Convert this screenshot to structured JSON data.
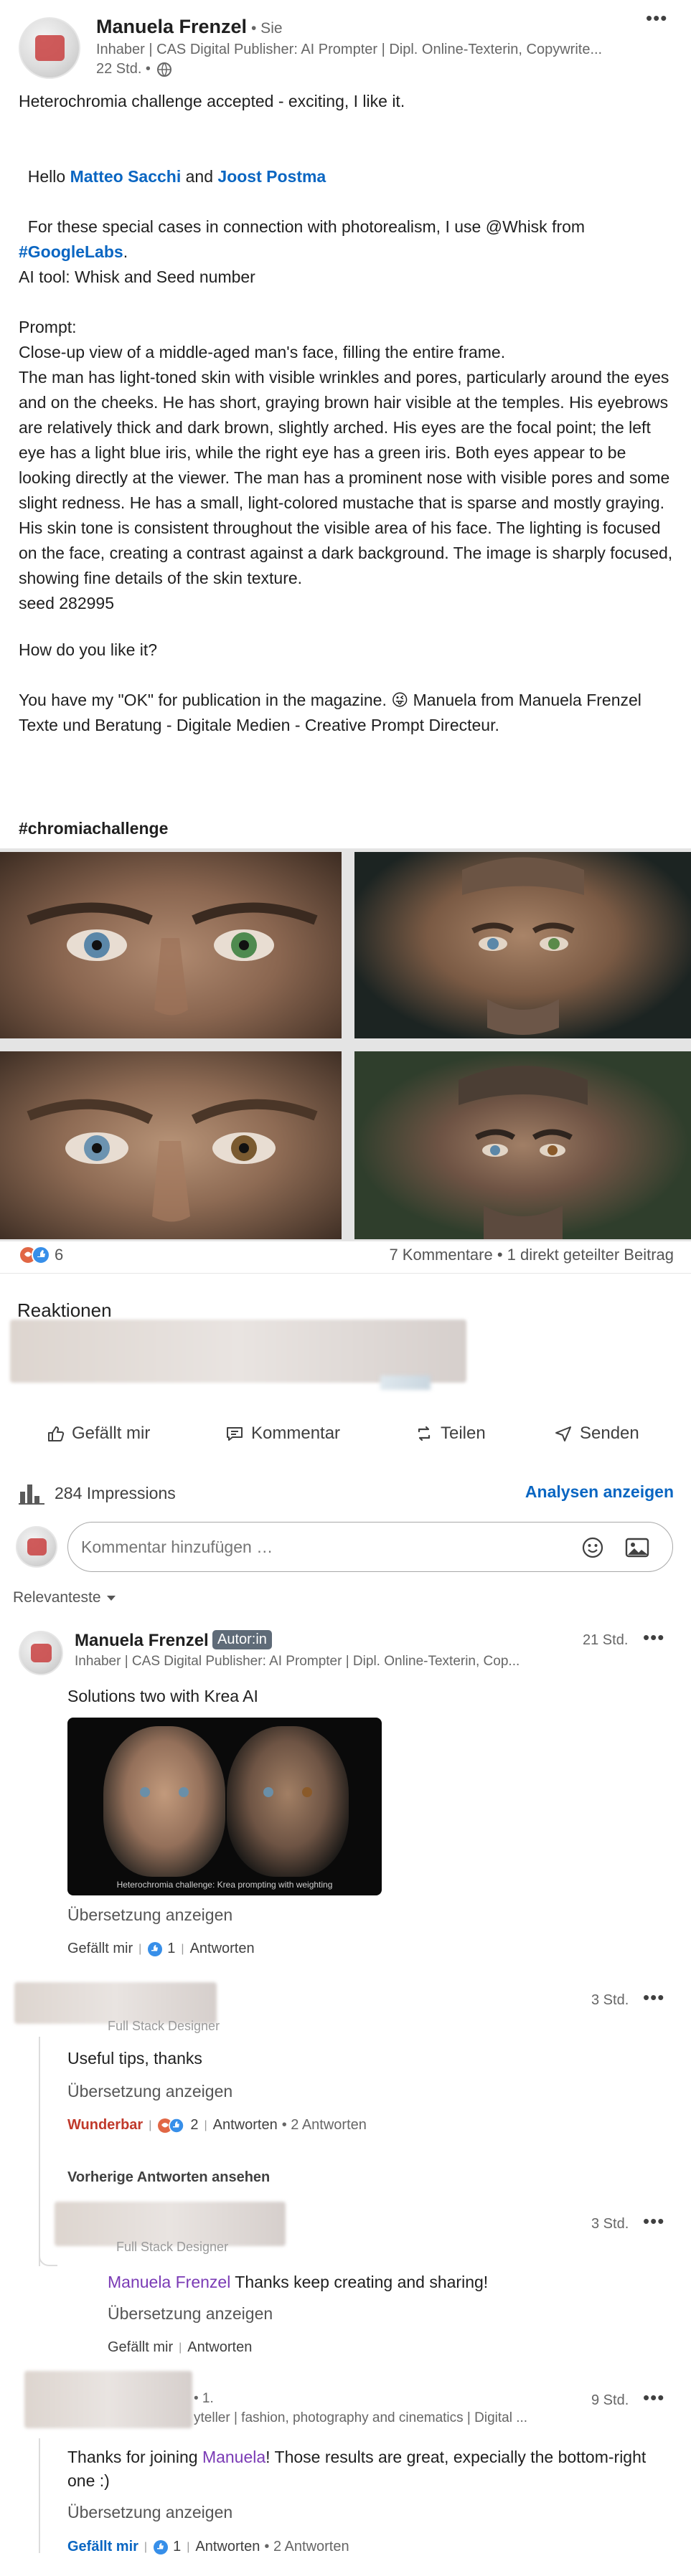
{
  "post": {
    "author_name": "Manuela Frenzel",
    "author_badge": "• Sie",
    "author_headline": "Inhaber | CAS Digital Publisher: AI Prompter | Dipl. Online-Texterin, Copywrite...",
    "time": "22 Std. •",
    "line1": "Heterochromia challenge accepted - exciting, I like it.",
    "hello_prefix": "Hello ",
    "mention1": "Matteo Sacchi",
    "and": " and ",
    "mention2": "Joost Postma",
    "line3a": "For these special cases in connection with photorealism, I use @Whisk from",
    "hashtag_google": "#GoogleLabs",
    "line3b": ".",
    "ai_tool": "AI tool: Whisk and Seed number",
    "prompt_label": "Prompt:",
    "prompt_text": "Close-up view of a middle-aged man's face, filling the entire frame.\nThe man has light-toned skin with visible wrinkles and pores, particularly around the eyes and on the cheeks. He has short, graying brown hair visible at the temples. His eyebrows are relatively thick and dark brown, slightly arched. His eyes are the focal point; the left eye has a light blue iris, while the right eye has a green iris. Both eyes appear to be looking directly at the viewer. The man has a prominent nose with visible pores and some slight redness. He has a small, light-colored mustache that is sparse and mostly graying. His skin tone is consistent throughout the visible area of his face. The lighting is focused on the face, creating a contrast against a dark background. The image is sharply focused, showing fine details of the skin texture.\nseed 282995",
    "question": "How do you like it?",
    "closing": "You have my \"OK\" for publication in the magazine. 😜 Manuela from Manuela Frenzel Texte und Beratung - Digitale Medien - Creative Prompt Directeur.",
    "hashtag": "#chromiachallenge"
  },
  "stats": {
    "reaction_count": "6",
    "comments_shares": "7 Kommentare • 1 direkt geteilter Beitrag"
  },
  "reactions_heading": "Reaktionen",
  "actions": {
    "like": "Gefällt mir",
    "comment": "Kommentar",
    "share": "Teilen",
    "send": "Senden"
  },
  "impressions": {
    "label": "284 Impressions",
    "analytics_link": "Analysen anzeigen"
  },
  "comment_box": {
    "placeholder": "Kommentar hinzufügen …"
  },
  "sort_label": "Relevanteste",
  "comments": [
    {
      "name": "Manuela Frenzel",
      "badge": "Autor:in",
      "headline": "Inhaber | CAS Digital Publisher: AI Prompter | Dipl. Online-Texterin, Cop...",
      "time": "21 Std.",
      "text": "Solutions two with Krea AI",
      "image_caption": "Heterochromia challenge: Krea prompting with weighting",
      "translate": "Übersetzung anzeigen",
      "like": "Gefällt mir",
      "like_count": "1",
      "reply": "Antworten"
    },
    {
      "headline": "Full Stack Designer",
      "time": "3 Std.",
      "text": "Useful tips, thanks",
      "translate": "Übersetzung anzeigen",
      "reaction_label": "Wunderbar",
      "like_count": "2",
      "reply": "Antworten",
      "replies": "2 Antworten",
      "prev_replies": "Vorherige Antworten ansehen"
    },
    {
      "headline": "Full Stack Designer",
      "time": "3 Std.",
      "mention": "Manuela Frenzel",
      "text": " Thanks keep creating and sharing!",
      "translate": "Übersetzung anzeigen",
      "like": "Gefällt mir",
      "reply": "Antworten"
    },
    {
      "degree": "• 1.",
      "headline": "yteller | fashion, photography and cinematics | Digital ...",
      "time": "9 Std.",
      "text_a": "Thanks for joining ",
      "mention": "Manuela",
      "text_b": "! Those results are great, expecially the bottom-right one :)",
      "translate": "Übersetzung anzeigen",
      "like": "Gefällt mir",
      "like_count": "1",
      "reply": "Antworten",
      "replies": "2 Antworten"
    }
  ],
  "colors": {
    "link": "#0a66c2",
    "mention_purple": "#7a3ab5",
    "wunderbar": "#c0392b"
  }
}
